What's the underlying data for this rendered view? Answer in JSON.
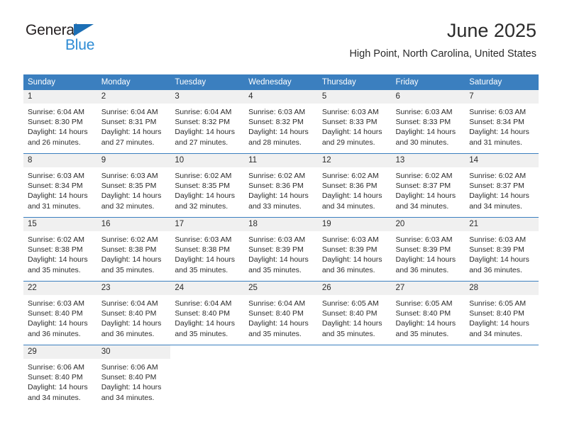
{
  "logo": {
    "word1": "General",
    "word2": "Blue",
    "triangle_color": "#1c6fb5",
    "word2_color": "#2e8bd4"
  },
  "header": {
    "title": "June 2025",
    "subtitle": "High Point, North Carolina, United States"
  },
  "theme": {
    "header_blue": "#3b7fbf",
    "daynum_gray": "#f0f0f0",
    "text": "#2b2b2b"
  },
  "calendar": {
    "weekday_headers": [
      "Sunday",
      "Monday",
      "Tuesday",
      "Wednesday",
      "Thursday",
      "Friday",
      "Saturday"
    ],
    "weeks": [
      [
        {
          "day": "1",
          "sunrise": "Sunrise: 6:04 AM",
          "sunset": "Sunset: 8:30 PM",
          "daylight_line1": "Daylight: 14 hours",
          "daylight_line2": "and 26 minutes."
        },
        {
          "day": "2",
          "sunrise": "Sunrise: 6:04 AM",
          "sunset": "Sunset: 8:31 PM",
          "daylight_line1": "Daylight: 14 hours",
          "daylight_line2": "and 27 minutes."
        },
        {
          "day": "3",
          "sunrise": "Sunrise: 6:04 AM",
          "sunset": "Sunset: 8:32 PM",
          "daylight_line1": "Daylight: 14 hours",
          "daylight_line2": "and 27 minutes."
        },
        {
          "day": "4",
          "sunrise": "Sunrise: 6:03 AM",
          "sunset": "Sunset: 8:32 PM",
          "daylight_line1": "Daylight: 14 hours",
          "daylight_line2": "and 28 minutes."
        },
        {
          "day": "5",
          "sunrise": "Sunrise: 6:03 AM",
          "sunset": "Sunset: 8:33 PM",
          "daylight_line1": "Daylight: 14 hours",
          "daylight_line2": "and 29 minutes."
        },
        {
          "day": "6",
          "sunrise": "Sunrise: 6:03 AM",
          "sunset": "Sunset: 8:33 PM",
          "daylight_line1": "Daylight: 14 hours",
          "daylight_line2": "and 30 minutes."
        },
        {
          "day": "7",
          "sunrise": "Sunrise: 6:03 AM",
          "sunset": "Sunset: 8:34 PM",
          "daylight_line1": "Daylight: 14 hours",
          "daylight_line2": "and 31 minutes."
        }
      ],
      [
        {
          "day": "8",
          "sunrise": "Sunrise: 6:03 AM",
          "sunset": "Sunset: 8:34 PM",
          "daylight_line1": "Daylight: 14 hours",
          "daylight_line2": "and 31 minutes."
        },
        {
          "day": "9",
          "sunrise": "Sunrise: 6:03 AM",
          "sunset": "Sunset: 8:35 PM",
          "daylight_line1": "Daylight: 14 hours",
          "daylight_line2": "and 32 minutes."
        },
        {
          "day": "10",
          "sunrise": "Sunrise: 6:02 AM",
          "sunset": "Sunset: 8:35 PM",
          "daylight_line1": "Daylight: 14 hours",
          "daylight_line2": "and 32 minutes."
        },
        {
          "day": "11",
          "sunrise": "Sunrise: 6:02 AM",
          "sunset": "Sunset: 8:36 PM",
          "daylight_line1": "Daylight: 14 hours",
          "daylight_line2": "and 33 minutes."
        },
        {
          "day": "12",
          "sunrise": "Sunrise: 6:02 AM",
          "sunset": "Sunset: 8:36 PM",
          "daylight_line1": "Daylight: 14 hours",
          "daylight_line2": "and 34 minutes."
        },
        {
          "day": "13",
          "sunrise": "Sunrise: 6:02 AM",
          "sunset": "Sunset: 8:37 PM",
          "daylight_line1": "Daylight: 14 hours",
          "daylight_line2": "and 34 minutes."
        },
        {
          "day": "14",
          "sunrise": "Sunrise: 6:02 AM",
          "sunset": "Sunset: 8:37 PM",
          "daylight_line1": "Daylight: 14 hours",
          "daylight_line2": "and 34 minutes."
        }
      ],
      [
        {
          "day": "15",
          "sunrise": "Sunrise: 6:02 AM",
          "sunset": "Sunset: 8:38 PM",
          "daylight_line1": "Daylight: 14 hours",
          "daylight_line2": "and 35 minutes."
        },
        {
          "day": "16",
          "sunrise": "Sunrise: 6:02 AM",
          "sunset": "Sunset: 8:38 PM",
          "daylight_line1": "Daylight: 14 hours",
          "daylight_line2": "and 35 minutes."
        },
        {
          "day": "17",
          "sunrise": "Sunrise: 6:03 AM",
          "sunset": "Sunset: 8:38 PM",
          "daylight_line1": "Daylight: 14 hours",
          "daylight_line2": "and 35 minutes."
        },
        {
          "day": "18",
          "sunrise": "Sunrise: 6:03 AM",
          "sunset": "Sunset: 8:39 PM",
          "daylight_line1": "Daylight: 14 hours",
          "daylight_line2": "and 35 minutes."
        },
        {
          "day": "19",
          "sunrise": "Sunrise: 6:03 AM",
          "sunset": "Sunset: 8:39 PM",
          "daylight_line1": "Daylight: 14 hours",
          "daylight_line2": "and 36 minutes."
        },
        {
          "day": "20",
          "sunrise": "Sunrise: 6:03 AM",
          "sunset": "Sunset: 8:39 PM",
          "daylight_line1": "Daylight: 14 hours",
          "daylight_line2": "and 36 minutes."
        },
        {
          "day": "21",
          "sunrise": "Sunrise: 6:03 AM",
          "sunset": "Sunset: 8:39 PM",
          "daylight_line1": "Daylight: 14 hours",
          "daylight_line2": "and 36 minutes."
        }
      ],
      [
        {
          "day": "22",
          "sunrise": "Sunrise: 6:03 AM",
          "sunset": "Sunset: 8:40 PM",
          "daylight_line1": "Daylight: 14 hours",
          "daylight_line2": "and 36 minutes."
        },
        {
          "day": "23",
          "sunrise": "Sunrise: 6:04 AM",
          "sunset": "Sunset: 8:40 PM",
          "daylight_line1": "Daylight: 14 hours",
          "daylight_line2": "and 36 minutes."
        },
        {
          "day": "24",
          "sunrise": "Sunrise: 6:04 AM",
          "sunset": "Sunset: 8:40 PM",
          "daylight_line1": "Daylight: 14 hours",
          "daylight_line2": "and 35 minutes."
        },
        {
          "day": "25",
          "sunrise": "Sunrise: 6:04 AM",
          "sunset": "Sunset: 8:40 PM",
          "daylight_line1": "Daylight: 14 hours",
          "daylight_line2": "and 35 minutes."
        },
        {
          "day": "26",
          "sunrise": "Sunrise: 6:05 AM",
          "sunset": "Sunset: 8:40 PM",
          "daylight_line1": "Daylight: 14 hours",
          "daylight_line2": "and 35 minutes."
        },
        {
          "day": "27",
          "sunrise": "Sunrise: 6:05 AM",
          "sunset": "Sunset: 8:40 PM",
          "daylight_line1": "Daylight: 14 hours",
          "daylight_line2": "and 35 minutes."
        },
        {
          "day": "28",
          "sunrise": "Sunrise: 6:05 AM",
          "sunset": "Sunset: 8:40 PM",
          "daylight_line1": "Daylight: 14 hours",
          "daylight_line2": "and 34 minutes."
        }
      ],
      [
        {
          "day": "29",
          "sunrise": "Sunrise: 6:06 AM",
          "sunset": "Sunset: 8:40 PM",
          "daylight_line1": "Daylight: 14 hours",
          "daylight_line2": "and 34 minutes."
        },
        {
          "day": "30",
          "sunrise": "Sunrise: 6:06 AM",
          "sunset": "Sunset: 8:40 PM",
          "daylight_line1": "Daylight: 14 hours",
          "daylight_line2": "and 34 minutes."
        },
        {
          "day": "",
          "sunrise": "",
          "sunset": "",
          "daylight_line1": "",
          "daylight_line2": ""
        },
        {
          "day": "",
          "sunrise": "",
          "sunset": "",
          "daylight_line1": "",
          "daylight_line2": ""
        },
        {
          "day": "",
          "sunrise": "",
          "sunset": "",
          "daylight_line1": "",
          "daylight_line2": ""
        },
        {
          "day": "",
          "sunrise": "",
          "sunset": "",
          "daylight_line1": "",
          "daylight_line2": ""
        },
        {
          "day": "",
          "sunrise": "",
          "sunset": "",
          "daylight_line1": "",
          "daylight_line2": ""
        }
      ]
    ]
  }
}
